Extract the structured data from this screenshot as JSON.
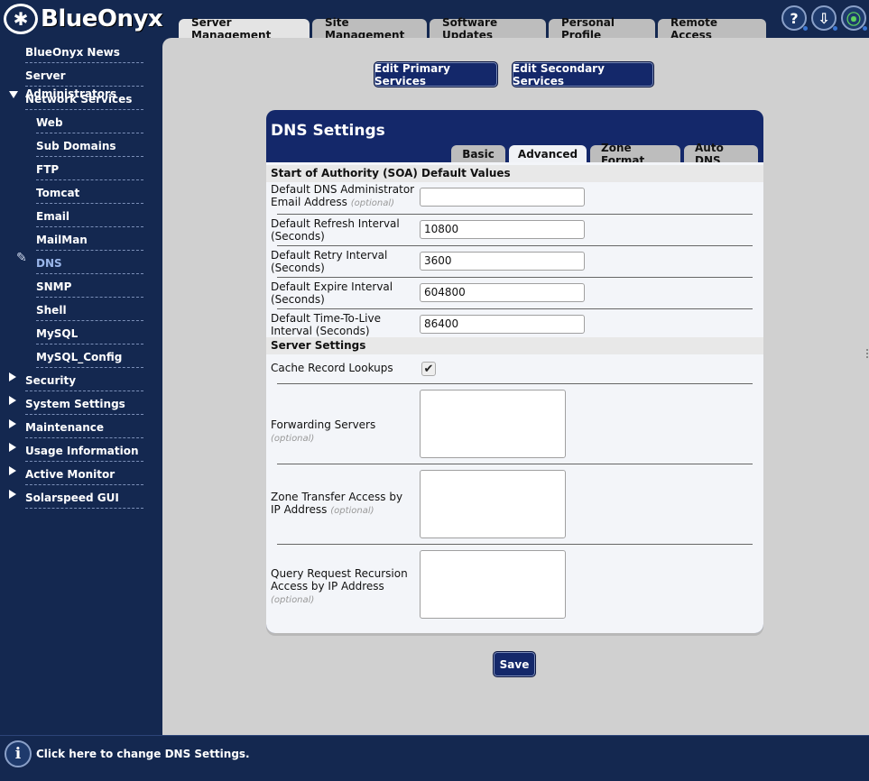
{
  "logo": {
    "mark": "✱",
    "text": "BlueOnyx"
  },
  "top_tabs": [
    "Server Management",
    "Site Management",
    "Software Updates",
    "Personal Profile",
    "Remote Access"
  ],
  "header_icons": {
    "help": "?",
    "download": "⇩",
    "monitor": "⦿"
  },
  "sidebar": {
    "items": [
      {
        "label": "BlueOnyx News"
      },
      {
        "label": "Server Administrators"
      },
      {
        "label": "Network Services"
      },
      {
        "label": "Web"
      },
      {
        "label": "Sub Domains"
      },
      {
        "label": "FTP"
      },
      {
        "label": "Tomcat"
      },
      {
        "label": "Email"
      },
      {
        "label": "MailMan"
      },
      {
        "label": "DNS"
      },
      {
        "label": "SNMP"
      },
      {
        "label": "Shell"
      },
      {
        "label": "MySQL"
      },
      {
        "label": "MySQL_Config"
      },
      {
        "label": "Security"
      },
      {
        "label": "System Settings"
      },
      {
        "label": "Maintenance"
      },
      {
        "label": "Usage Information"
      },
      {
        "label": "Active Monitor"
      },
      {
        "label": "Solarspeed GUI"
      }
    ]
  },
  "buttons": {
    "edit_primary": "Edit Primary Services",
    "edit_secondary": "Edit Secondary Services",
    "save": "Save"
  },
  "panel": {
    "title": "DNS Settings",
    "tabs": [
      "Basic",
      "Advanced",
      "Zone Format",
      "Auto DNS"
    ],
    "soa_header": "Start of Authority (SOA) Default Values",
    "admin_email_label": "Default DNS Administrator Email Address",
    "admin_email_value": "",
    "refresh_label": "Default Refresh Interval (Seconds)",
    "refresh_value": "10800",
    "retry_label": "Default Retry Interval (Seconds)",
    "retry_value": "3600",
    "expire_label": "Default Expire Interval (Seconds)",
    "expire_value": "604800",
    "ttl_label": "Default Time-To-Live Interval (Seconds)",
    "ttl_value": "86400",
    "server_header": "Server Settings",
    "cache_label": "Cache Record Lookups",
    "cache_checked": "✔",
    "forwarding_label": "Forwarding Servers",
    "zone_transfer_label": "Zone Transfer Access by IP Address",
    "recursion_label": "Query Request Recursion Access by IP Address",
    "optional": "(optional)"
  },
  "footer": {
    "info_icon": "i",
    "text": "Click here to change DNS Settings."
  }
}
